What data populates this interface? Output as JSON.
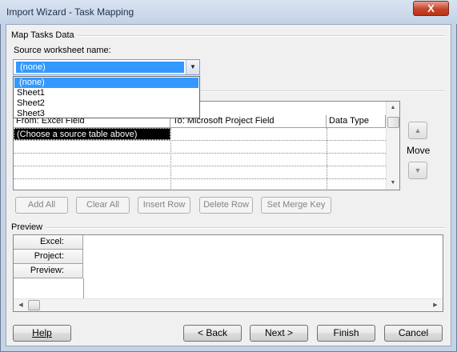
{
  "window": {
    "title": "Import Wizard - Task Mapping",
    "close_glyph": "X"
  },
  "map_tasks": {
    "section_label": "Map Tasks Data",
    "source_label": "Source worksheet name:",
    "combo_value": "(none)",
    "dropdown_items": [
      "(none)",
      "Sheet1",
      "Sheet2",
      "Sheet3"
    ]
  },
  "grid": {
    "columns": [
      "From: Excel Field",
      "To:  Microsoft Project Field",
      "Data Type"
    ],
    "rows": [
      [
        "(Choose a source table above)",
        "",
        ""
      ],
      [
        "",
        "",
        ""
      ],
      [
        "",
        "",
        ""
      ],
      [
        "",
        "",
        ""
      ],
      [
        "",
        "",
        ""
      ]
    ]
  },
  "move": {
    "label": "Move",
    "up_icon": "triangle-up-icon",
    "down_icon": "triangle-down-icon"
  },
  "row_buttons": [
    "Add All",
    "Clear All",
    "Insert Row",
    "Delete Row",
    "Set Merge Key"
  ],
  "preview": {
    "section_label": "Preview",
    "row_headers": [
      "Excel:",
      "Project:",
      "Preview:"
    ]
  },
  "footer": {
    "help": "Help",
    "back": "< Back",
    "next": "Next >",
    "finish": "Finish",
    "cancel": "Cancel"
  }
}
